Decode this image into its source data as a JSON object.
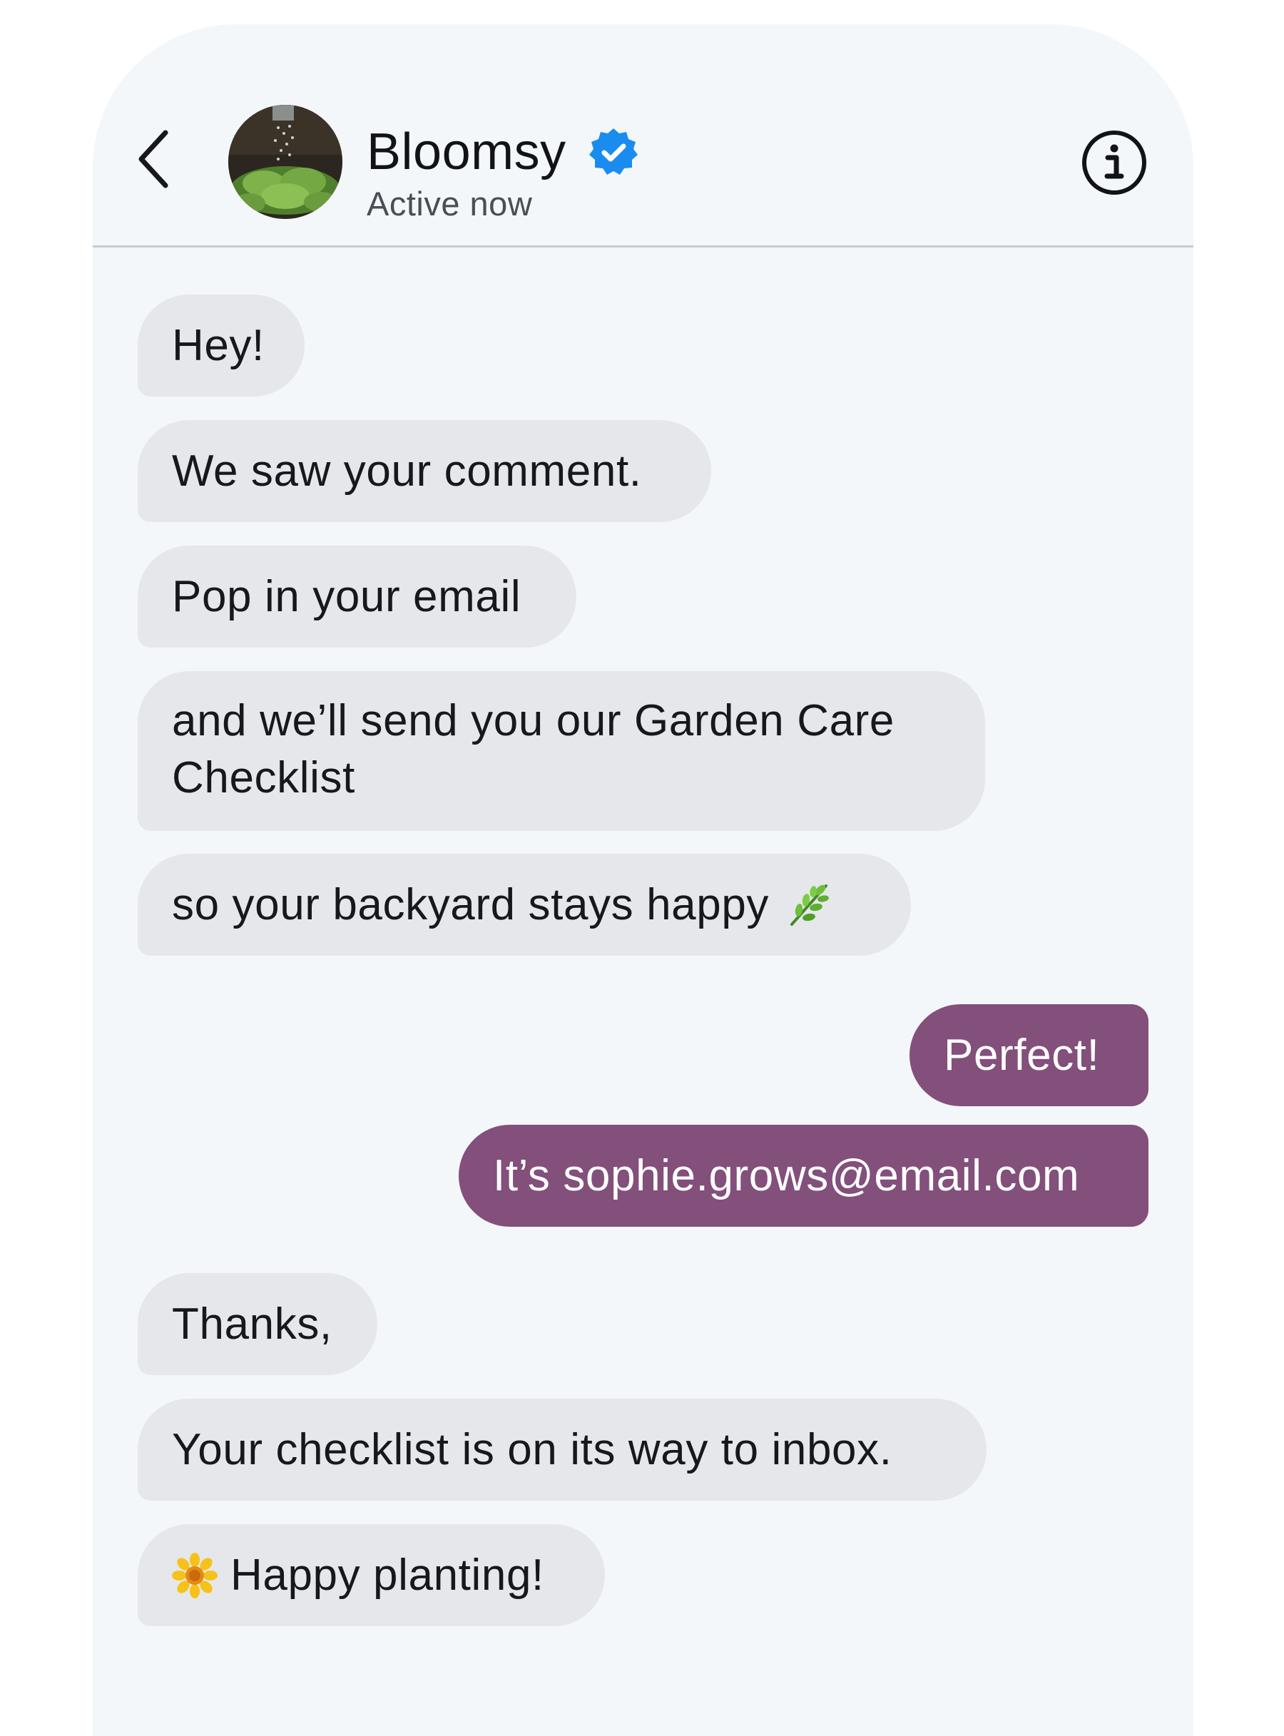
{
  "header": {
    "contact_name": "Bloomsy",
    "status": "Active now"
  },
  "messages": [
    {
      "direction": "incoming",
      "text": "Hey!"
    },
    {
      "direction": "incoming",
      "text": "We saw your comment."
    },
    {
      "direction": "incoming",
      "text": "Pop in your email"
    },
    {
      "direction": "incoming",
      "text": "and we’ll send you our Garden Care Checklist"
    },
    {
      "direction": "incoming",
      "text": "so your backyard stays happy",
      "emoji": "herb-emoji"
    },
    {
      "direction": "outgoing",
      "text": "Perfect!"
    },
    {
      "direction": "outgoing",
      "text": "It’s sophie.grows@email.com"
    },
    {
      "direction": "incoming",
      "text": "Thanks,"
    },
    {
      "direction": "incoming",
      "text": "Your checklist is on its way to inbox."
    },
    {
      "direction": "incoming",
      "text": "Happy planting!",
      "emoji": "sunflower-emoji"
    }
  ],
  "colors": {
    "incoming_bubble": "#e5e7ea",
    "outgoing_bubble": "#834f7b",
    "verified_badge": "#1a8cf0"
  },
  "icons": [
    "back-chevron-icon",
    "verified-badge-icon",
    "info-icon"
  ]
}
